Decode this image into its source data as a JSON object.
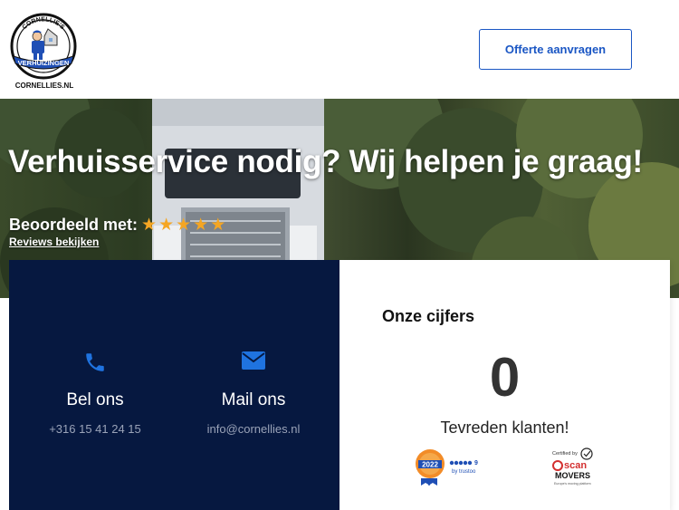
{
  "header": {
    "logo_text_top": "CORNELLIE'S",
    "logo_text_band": "VERHUIZINGEN",
    "logo_text_bottom": "CORNELLIES.NL",
    "cta_label": "Offerte aanvragen"
  },
  "hero": {
    "title": "Verhuisservice nodig? Wij helpen je graag!",
    "rating_label": "Beoordeeld met:",
    "rating_stars": 5,
    "reviews_link": "Reviews bekijken"
  },
  "contact": {
    "phone": {
      "icon": "phone-icon",
      "title": "Bel ons",
      "value": "+316 15 41 24 15"
    },
    "mail": {
      "icon": "envelope-icon",
      "title": "Mail ons",
      "value": "info@cornellies.nl"
    }
  },
  "stats": {
    "title": "Onze cijfers",
    "number": "0",
    "label": "Tevreden klanten!"
  },
  "badges": {
    "trustoo_year": "2022",
    "trustoo_score": "9",
    "trustoo_by": "by trustoo",
    "scan_certified": "Certified by",
    "scan_name": "scan",
    "scan_movers": "MOVERS",
    "scan_tagline": "Europe's moving platform"
  },
  "colors": {
    "accent_blue": "#1a56c4",
    "dark_navy": "#061840",
    "star_orange": "#f5a623"
  }
}
